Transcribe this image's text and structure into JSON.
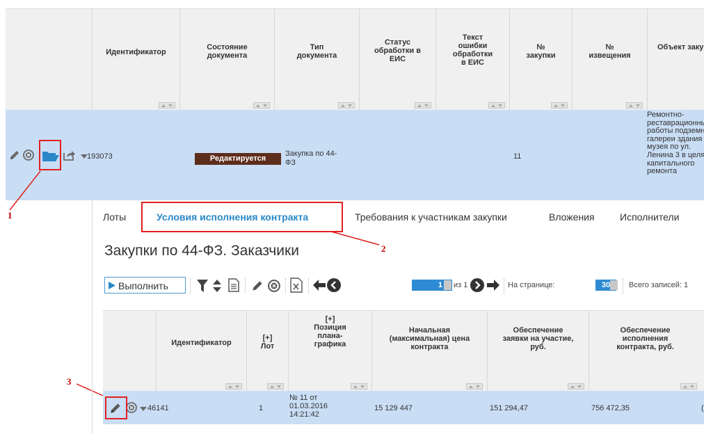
{
  "top_grid": {
    "columns": [
      {
        "label": "Идентификатор"
      },
      {
        "label": "Состояние документа"
      },
      {
        "label": "Тип документа"
      },
      {
        "label": "Статус обработки в ЕИС"
      },
      {
        "label": "Текст ошибки обработки в ЕИС"
      },
      {
        "label": "№ закупки"
      },
      {
        "label": "№ извещения"
      },
      {
        "label": "Объект закупки"
      }
    ],
    "row": {
      "id": "193073",
      "state": "Редактируется",
      "doc_type": "Закупка по 44-ФЗ",
      "purchase_no": "11",
      "object": "Ремонтно-реставрационные работы подземной галереи здания музея по ул. Ленина 3 в целях капитального ремонта"
    }
  },
  "annotations": {
    "one": "1",
    "two": "2",
    "three": "3"
  },
  "tabs": [
    {
      "label": "Лоты"
    },
    {
      "label": "Условия исполнения контракта"
    },
    {
      "label": "Требования к участникам закупки"
    },
    {
      "label": "Вложения"
    },
    {
      "label": "Исполнители"
    }
  ],
  "section_title": "Закупки по 44-ФЗ. Заказчики",
  "toolbar": {
    "run_label": "Выполнить",
    "page_current": "1",
    "page_of": "из 1",
    "per_page_label": "На странице:",
    "per_page_value": "30",
    "total_label": "Всего записей: 1"
  },
  "inner_grid": {
    "columns": [
      {
        "label": "Идентификатор"
      },
      {
        "label": "[+] Лот"
      },
      {
        "label": "[+] Позиция плана-графика"
      },
      {
        "label": "Начальная (максимальная) цена контракта"
      },
      {
        "label": "Обеспечение заявки на участие, руб."
      },
      {
        "label": "Обеспечение исполнения контракта, руб."
      }
    ],
    "row": {
      "id": "46141",
      "lot": "1",
      "plan_position": "№ 11 от 01.03.2016 14:21:42",
      "max_price": "15 129 447",
      "bid_security": "151 294,47",
      "contract_security": "756 472,35",
      "trail": "("
    }
  },
  "colors": {
    "accent": "#2a87c8",
    "selected_row": "#c9def5",
    "badge": "#5d2d1b",
    "highlight": "#e02020"
  }
}
